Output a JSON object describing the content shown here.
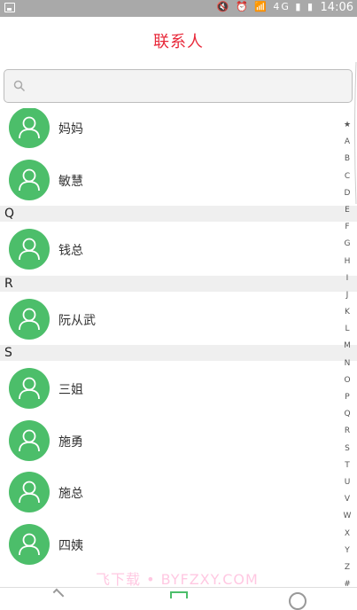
{
  "statusbar": {
    "time": "14:06",
    "network": "4G"
  },
  "header": {
    "title": "联系人"
  },
  "search": {
    "placeholder": ""
  },
  "sections": [
    {
      "letter": "",
      "contacts": [
        "妈妈",
        "敏慧"
      ]
    },
    {
      "letter": "Q",
      "contacts": [
        "钱总"
      ]
    },
    {
      "letter": "R",
      "contacts": [
        "阮从武"
      ]
    },
    {
      "letter": "S",
      "contacts": [
        "三姐",
        "施勇",
        "施总",
        "四姨"
      ]
    }
  ],
  "index_letters": [
    "★",
    "A",
    "B",
    "C",
    "D",
    "E",
    "F",
    "G",
    "H",
    "I",
    "J",
    "K",
    "L",
    "M",
    "N",
    "O",
    "P",
    "Q",
    "R",
    "S",
    "T",
    "U",
    "V",
    "W",
    "X",
    "Y",
    "Z",
    "#"
  ],
  "watermark": "飞下载 • BYFZXY.COM",
  "colors": {
    "accent": "#e8293a",
    "avatar": "#4cbe6a"
  }
}
